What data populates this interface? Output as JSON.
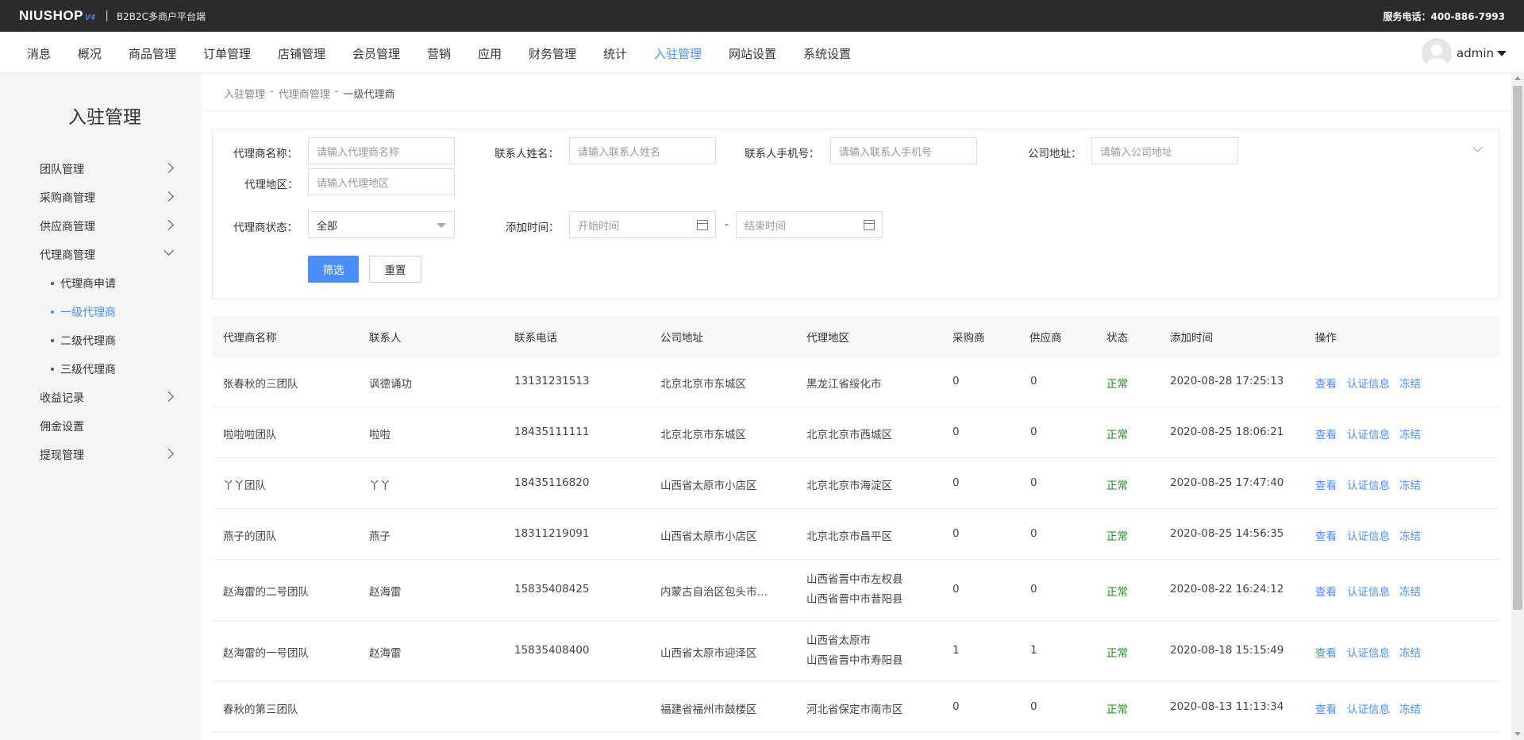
{
  "topbar": {
    "logo": "NIUSHOP",
    "logo_version": "V4",
    "subtitle": "B2B2C多商户平台端",
    "hotline": "服务电话：400-886-7993"
  },
  "nav": {
    "items": [
      "消息",
      "概况",
      "商品管理",
      "订单管理",
      "店铺管理",
      "会员管理",
      "营销",
      "应用",
      "财务管理",
      "统计",
      "入驻管理",
      "网站设置",
      "系统设置"
    ],
    "active": "入驻管理",
    "username": "admin"
  },
  "sidebar": {
    "title": "入驻管理",
    "items": {
      "team": "团队管理",
      "purchaser": "采购商管理",
      "supplier": "供应商管理",
      "agent": "代理商管理",
      "agent_apply": "代理商申请",
      "agent_l1": "一级代理商",
      "agent_l2": "二级代理商",
      "agent_l3": "三级代理商",
      "income": "收益记录",
      "commission": "佣金设置",
      "withdraw": "提现管理"
    }
  },
  "breadcrumb": [
    "入驻管理",
    "代理商管理",
    "一级代理商"
  ],
  "breadcrumb_sep": "-",
  "filter": {
    "agent_name_label": "代理商名称：",
    "agent_name_placeholder": "请输入代理商名称",
    "contact_name_label": "联系人姓名：",
    "contact_name_placeholder": "请输入联系人姓名",
    "contact_phone_label": "联系人手机号：",
    "contact_phone_placeholder": "请输入联系人手机号",
    "address_label": "公司地址：",
    "address_placeholder": "请输入公司地址",
    "region_label": "代理地区：",
    "region_placeholder": "请输入代理地区",
    "status_label": "代理商状态：",
    "status_value": "全部",
    "time_label": "添加时间：",
    "start_placeholder": "开始时间",
    "end_placeholder": "结束时间",
    "time_sep": "-",
    "submit": "筛选",
    "reset": "重置"
  },
  "table": {
    "headers": [
      "代理商名称",
      "联系人",
      "联系电话",
      "公司地址",
      "代理地区",
      "采购商",
      "供应商",
      "状态",
      "添加时间",
      "操作"
    ],
    "rows": [
      {
        "name": "张春秋的三团队",
        "contact": "讽德诵功",
        "phone": "13131231513",
        "address": "北京北京市东城区",
        "region": [
          "黑龙江省绥化市"
        ],
        "purchasers": "0",
        "suppliers": "0",
        "status": "正常",
        "time": "2020-08-28 17:25:13"
      },
      {
        "name": "啦啦啦团队",
        "contact": "啦啦",
        "phone": "18435111111",
        "address": "北京北京市东城区",
        "region": [
          "北京北京市西城区"
        ],
        "purchasers": "0",
        "suppliers": "0",
        "status": "正常",
        "time": "2020-08-25 18:06:21"
      },
      {
        "name": "丫丫团队",
        "contact": "丫丫",
        "phone": "18435116820",
        "address": "山西省太原市小店区",
        "region": [
          "北京北京市海淀区"
        ],
        "purchasers": "0",
        "suppliers": "0",
        "status": "正常",
        "time": "2020-08-25 17:47:40"
      },
      {
        "name": "燕子的团队",
        "contact": "燕子",
        "phone": "18311219091",
        "address": "山西省太原市小店区",
        "region": [
          "北京北京市昌平区"
        ],
        "purchasers": "0",
        "suppliers": "0",
        "status": "正常",
        "time": "2020-08-25 14:56:35"
      },
      {
        "name": "赵海雷的二号团队",
        "contact": "赵海雷",
        "phone": "15835408425",
        "address": "内蒙古自治区包头市…",
        "region": [
          "山西省晋中市左权县",
          "山西省晋中市昔阳县"
        ],
        "purchasers": "0",
        "suppliers": "0",
        "status": "正常",
        "time": "2020-08-22 16:24:12"
      },
      {
        "name": "赵海雷的一号团队",
        "contact": "赵海雷",
        "phone": "15835408400",
        "address": "山西省太原市迎泽区",
        "region": [
          "山西省太原市",
          "山西省晋中市寿阳县"
        ],
        "purchasers": "1",
        "suppliers": "1",
        "status": "正常",
        "time": "2020-08-18 15:15:49"
      },
      {
        "name": "春秋的第三团队",
        "contact": "",
        "phone": "",
        "address": "福建省福州市鼓楼区",
        "region": [
          "河北省保定市南市区"
        ],
        "purchasers": "0",
        "suppliers": "0",
        "status": "正常",
        "time": "2020-08-13 11:13:34"
      }
    ],
    "actions": [
      "查看",
      "认证信息",
      "冻结"
    ]
  },
  "colors": {
    "accent": "#4a8ff7",
    "status_ok": "#1a8a1a",
    "topbar": "#2b2b2b"
  }
}
